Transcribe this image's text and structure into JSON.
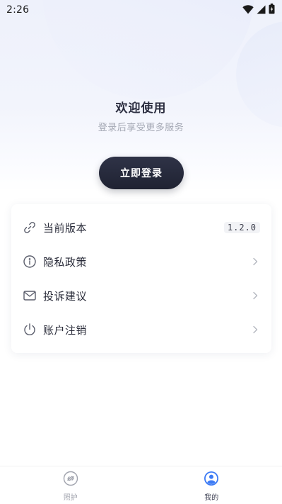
{
  "status_bar": {
    "time": "2:26",
    "icons": [
      "wifi-icon",
      "signal-icon",
      "battery-icon"
    ]
  },
  "welcome": {
    "title": "欢迎使用",
    "subtitle": "登录后享受更多服务"
  },
  "login_button": {
    "label": "立即登录"
  },
  "menu": {
    "items": [
      {
        "icon": "link-icon",
        "label": "当前版本",
        "value": "1.2.0"
      },
      {
        "icon": "info-icon",
        "label": "隐私政策"
      },
      {
        "icon": "mail-icon",
        "label": "投诉建议"
      },
      {
        "icon": "power-icon",
        "label": "账户注销"
      }
    ]
  },
  "tab_bar": {
    "tabs": [
      {
        "icon": "care-icon",
        "label": "照护",
        "active": false
      },
      {
        "icon": "profile-icon",
        "label": "我的",
        "active": true
      }
    ]
  },
  "colors": {
    "accent": "#3d7bf5",
    "button_dark": "#262a3b",
    "text_primary": "#2a2c3a",
    "text_secondary": "#a3a7b3"
  }
}
